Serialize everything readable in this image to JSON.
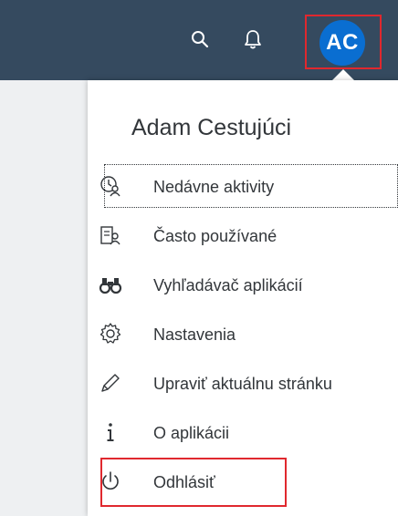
{
  "shellbar": {
    "search_icon": "search-icon",
    "notifications_icon": "bell-icon",
    "avatar_initials": "AC",
    "background_color": "#354a5f",
    "avatar_color": "#0a6ed1",
    "highlight_color": "#e0282e"
  },
  "popover": {
    "user_name": "Adam Cestujúci",
    "items": [
      {
        "label": "Nedávne aktivity",
        "icon": "recent-activity-icon"
      },
      {
        "label": "Často používané",
        "icon": "frequently-used-icon"
      },
      {
        "label": "Vyhľadávač aplikácií",
        "icon": "binoculars-icon"
      },
      {
        "label": "Nastavenia",
        "icon": "gear-icon"
      },
      {
        "label": "Upraviť aktuálnu stránku",
        "icon": "pencil-icon"
      },
      {
        "label": "O aplikácii",
        "icon": "info-icon"
      },
      {
        "label": "Odhlásiť",
        "icon": "power-icon"
      }
    ]
  }
}
